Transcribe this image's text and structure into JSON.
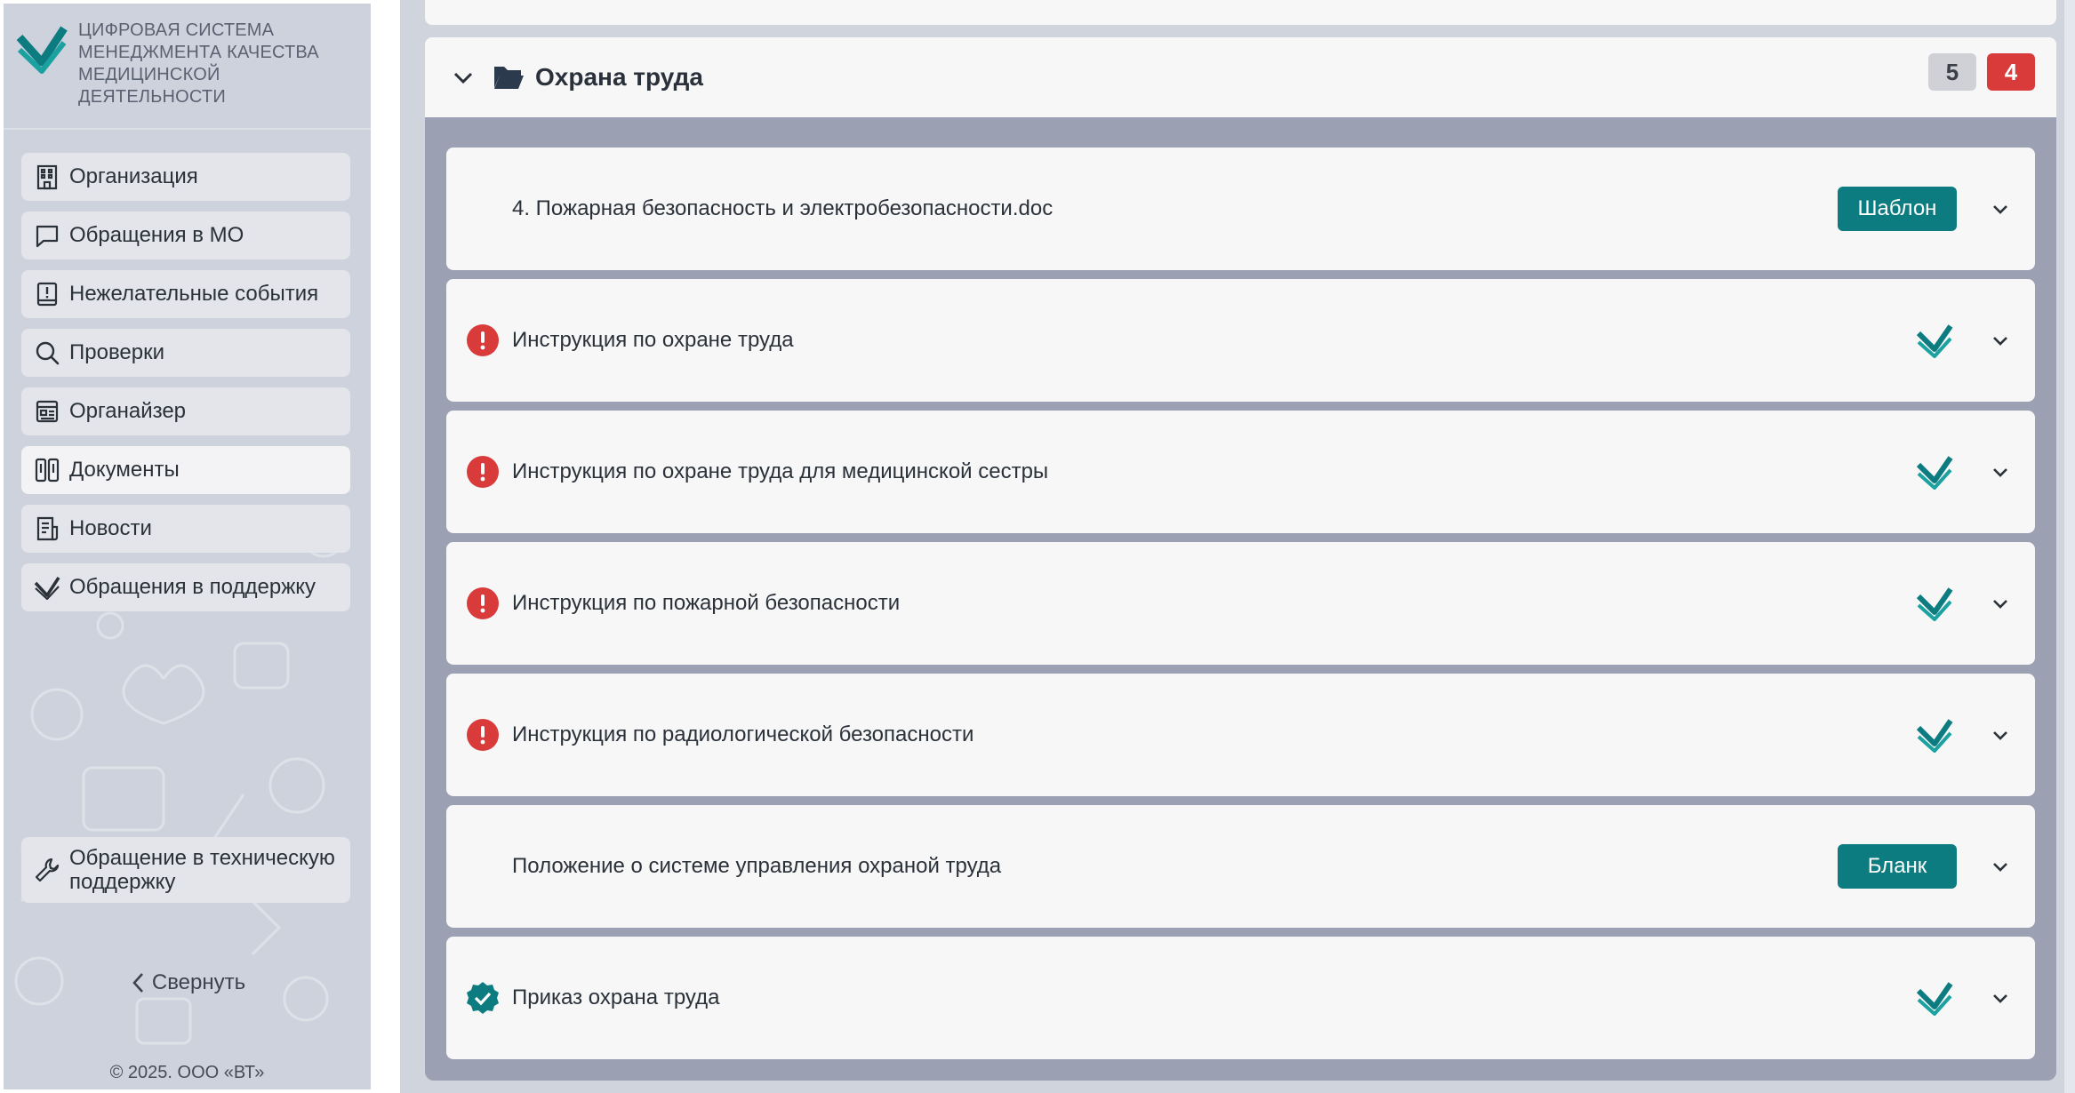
{
  "sidebar": {
    "brand_lines": [
      "ЦИФРОВАЯ СИСТЕМА",
      "МЕНЕДЖМЕНТА КАЧЕСТВА",
      "МЕДИЦИНСКОЙ",
      "ДЕЯТЕЛЬНОСТИ"
    ],
    "items": [
      {
        "label": "Организация",
        "icon": "building-icon"
      },
      {
        "label": "Обращения в МО",
        "icon": "chat-icon"
      },
      {
        "label": "Нежелательные события",
        "icon": "alert-book-icon"
      },
      {
        "label": "Проверки",
        "icon": "search-icon"
      },
      {
        "label": "Органайзер",
        "icon": "organizer-icon"
      },
      {
        "label": "Документы",
        "icon": "documents-icon",
        "active": true
      },
      {
        "label": "Новости",
        "icon": "news-icon"
      },
      {
        "label": "Обращения в поддержку",
        "icon": "support-check-icon"
      }
    ],
    "support_label": "Обращение в техническую поддержку",
    "collapse_label": "Свернуть",
    "copyright": "© 2025. ООО «ВТ»"
  },
  "section": {
    "title": "Охрана труда",
    "badge_total": "5",
    "badge_alert": "4"
  },
  "documents": [
    {
      "title": "4. Пожарная безопасность и электробезопасности.doc",
      "status": "none",
      "tag": "Шаблон"
    },
    {
      "title": "Инструкция по охране труда",
      "status": "error",
      "tag": ""
    },
    {
      "title": "Инструкция по охране труда для медицинской сестры",
      "status": "error",
      "tag": ""
    },
    {
      "title": "Инструкция по пожарной безопасности",
      "status": "error",
      "tag": ""
    },
    {
      "title": "Инструкция по радиологической безопасности",
      "status": "error",
      "tag": ""
    },
    {
      "title": "Положение о системе управления охраной труда",
      "status": "none",
      "tag": "Бланк"
    },
    {
      "title": "Приказ охрана труда",
      "status": "approved",
      "tag": ""
    }
  ],
  "colors": {
    "accent": "#0d7c80",
    "error": "#d93b3b",
    "sidebar_bg": "#ced2dd",
    "section_body": "#9ba1b2"
  }
}
